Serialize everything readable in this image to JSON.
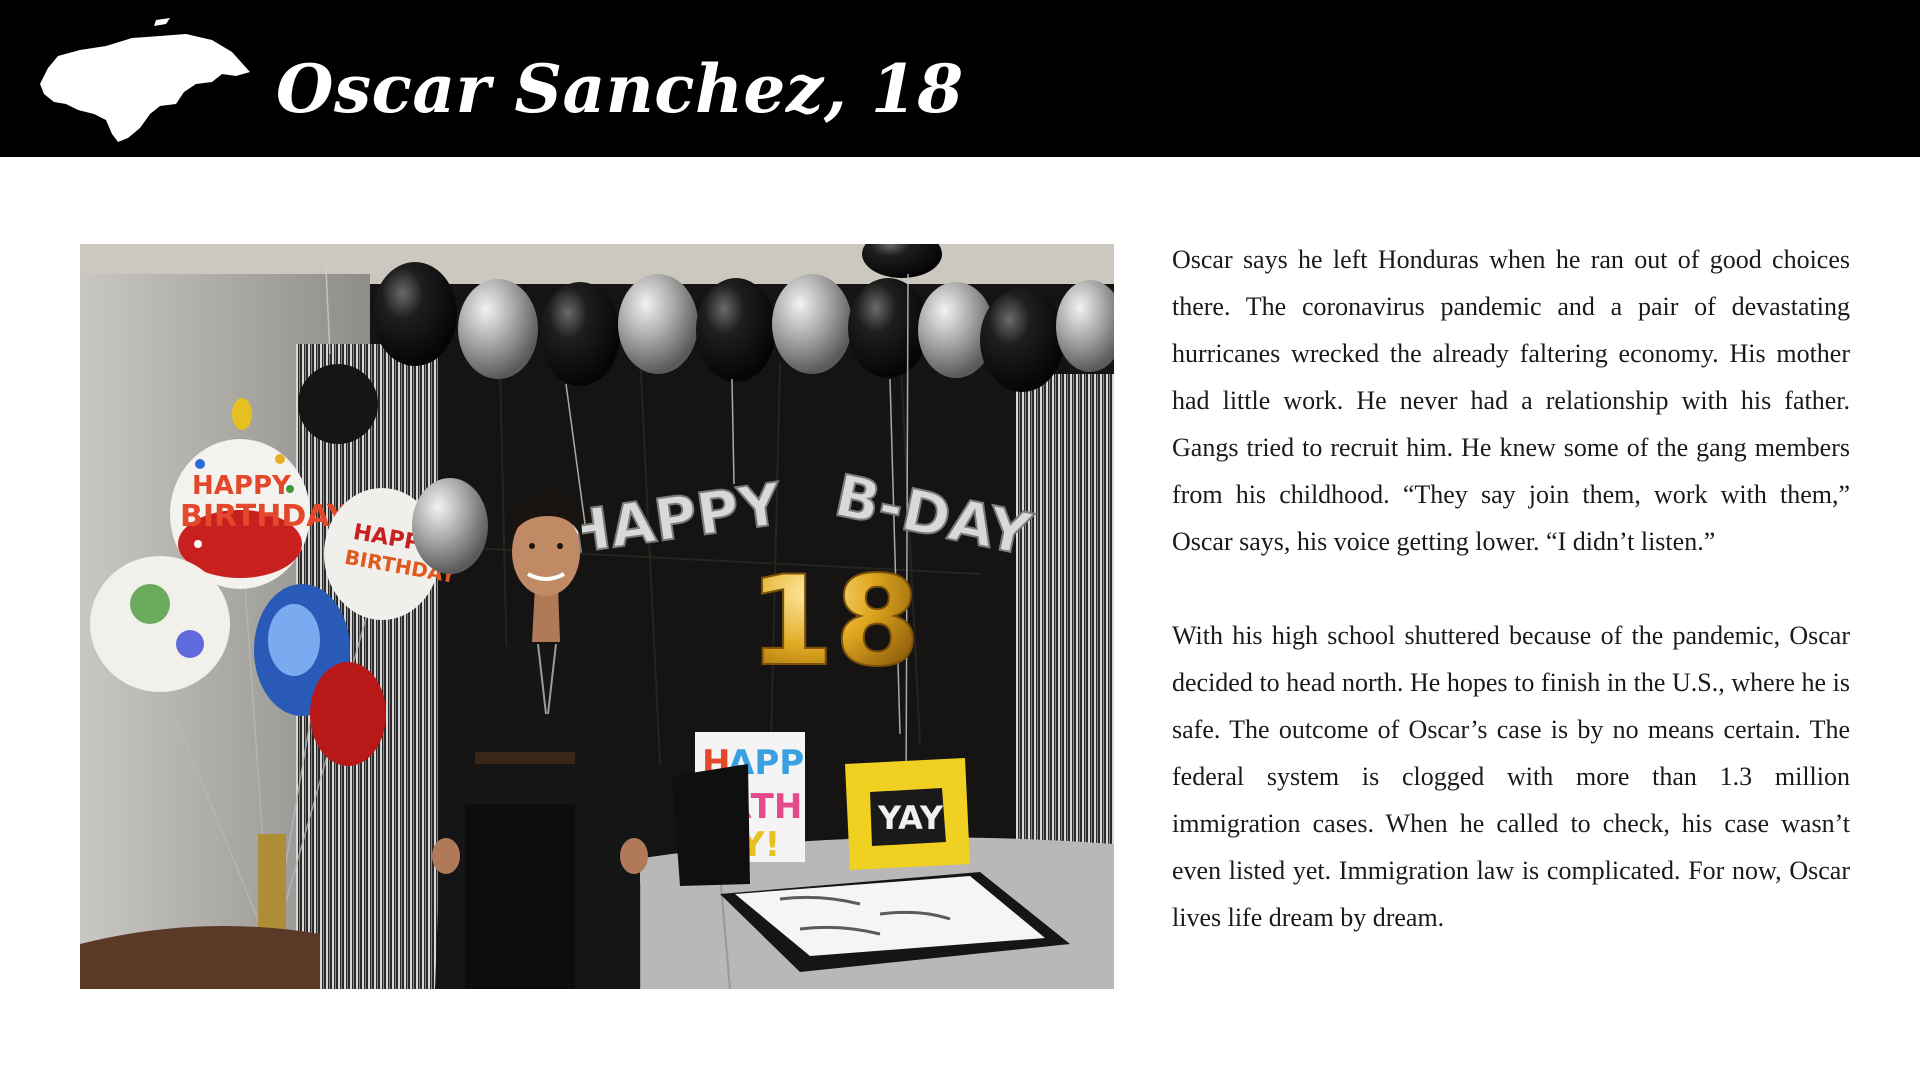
{
  "header": {
    "title": "Oscar Sanchez, 18",
    "background": "#000000",
    "icon": "honduras-map-silhouette-icon"
  },
  "photo": {
    "balloon_text": {
      "happy": "HAPPY",
      "bday": "B-DAY",
      "age": "18"
    },
    "bag_text": "YAY"
  },
  "story": {
    "paragraphs": [
      "Oscar says he left Honduras when he ran out of good choices there. The coronavirus pandemic and a pair of devastating hurricanes wrecked the already faltering economy. His mother had little work. He never had a relationship with his father. Gangs tried to recruit him. He knew some of the gang members from his childhood. “They say join them, work with them,” Oscar says, his voice getting lower. “I didn’t listen.”",
      "With his high school shuttered because of the pandemic, Oscar decided to head north. He hopes to finish in the U.S., where he is safe. The outcome of Oscar’s case is by no means certain. The federal system is clogged with more than 1.3 million immigration cases. When he called to check, his case wasn’t even listed yet. Immigration law is complicated. For now, Oscar lives life dream by dream."
    ]
  }
}
